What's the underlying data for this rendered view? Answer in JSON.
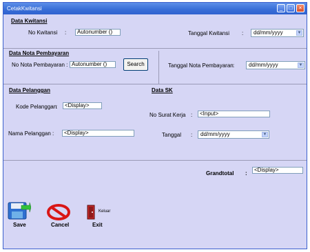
{
  "window": {
    "title": "CetakKwitansi",
    "controls": [
      "minimize-icon",
      "maximize-icon",
      "close-icon"
    ]
  },
  "kwitansi": {
    "section_title": "Data Kwitansi",
    "no_label": "No Kwitansi",
    "no_colon": ":",
    "no_value": "Autonumber ()",
    "tanggal_label": "Tanggal Kwitansi",
    "tanggal_colon": ":",
    "tanggal_value": "dd/mm/yyyy"
  },
  "nota": {
    "section_title": "Data Nota Pembayaran",
    "no_label": "No Nota Pembayaran :",
    "no_value": "Autonumber ()",
    "search_label": "Search",
    "tanggal_label": "Tanggal Nota Pembayaran",
    "tanggal_colon": ":",
    "tanggal_value": "dd/mm/yyyy"
  },
  "pelanggan": {
    "section_title": "Data Pelanggan",
    "kode_label": "Kode Pelanggan",
    "kode_colon": ":",
    "kode_value": "<Display>",
    "nama_label": "Nama Pelanggan :",
    "nama_value": "<Display>"
  },
  "sk": {
    "section_title": "Data SK",
    "no_label": "No Surat Kerja",
    "no_colon": ":",
    "no_value": "<Input>",
    "tanggal_label": "Tanggal",
    "tanggal_colon": ":",
    "tanggal_value": "dd/mm/yyyy"
  },
  "grandtotal": {
    "label": "Grandtotal",
    "colon": ":",
    "value": "<Display>"
  },
  "actions": {
    "save_label": "Save",
    "cancel_label": "Cancel",
    "exit_label": "Exit",
    "exit_icon_text": "Keluar"
  }
}
